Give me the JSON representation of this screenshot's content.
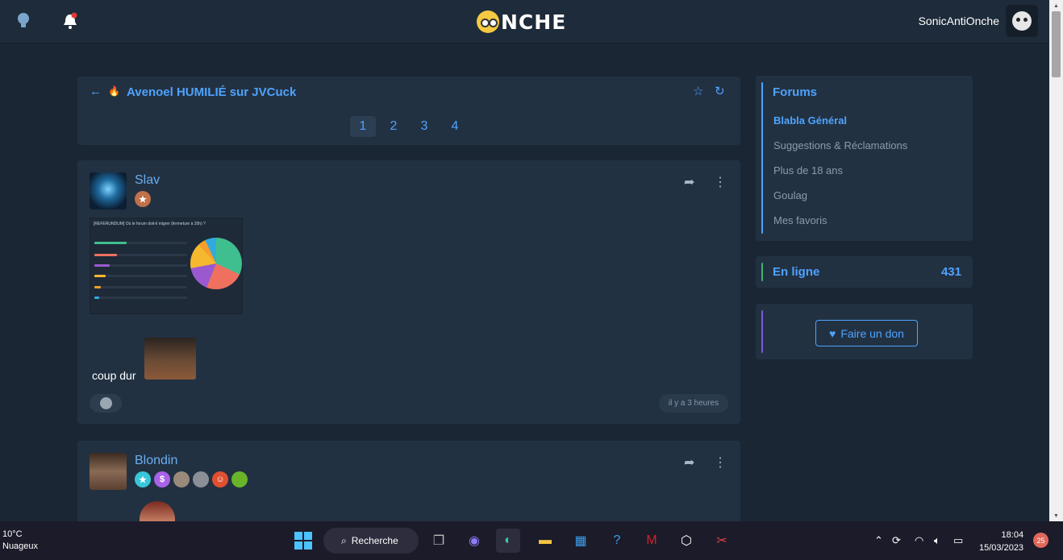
{
  "header": {
    "logo_text": "NCHE",
    "username": "SonicAntiOnche",
    "icons": [
      "lightbulb-icon",
      "bell-icon",
      "onche-face-logo",
      "user-avatar"
    ]
  },
  "topic": {
    "title": "Avenoel HUMILIÉ sur JVCuck",
    "pages": [
      "1",
      "2",
      "3",
      "4"
    ],
    "active_page": "1"
  },
  "posts": [
    {
      "author": "Slav",
      "text": "coup dur",
      "time": "il y a 3 heures",
      "poll_image": {
        "title": "[REFERUNDUM] Où le forum doit-il migrer (fermeture à 20h) ?",
        "slices_percent": [
          32,
          24,
          16,
          16,
          5,
          7
        ],
        "slice_colors": [
          "#3fbf8f",
          "#f07060",
          "#9b59d0",
          "#f5b82e",
          "#f59e2b",
          "#33aadd"
        ]
      }
    },
    {
      "author": "Blondin",
      "badge_colors": [
        "#38c6d9",
        "#a862e8",
        "#9a8a7a",
        "#8a8f96",
        "#e05030",
        "#6ab42a"
      ]
    }
  ],
  "sidebar": {
    "forums_title": "Forums",
    "forums": [
      {
        "label": "Blabla Général",
        "active": true
      },
      {
        "label": "Suggestions & Réclamations",
        "active": false
      },
      {
        "label": "Plus de 18 ans",
        "active": false
      },
      {
        "label": "Goulag",
        "active": false
      },
      {
        "label": "Mes favoris",
        "active": false
      }
    ],
    "online_label": "En ligne",
    "online_count": "431",
    "donate_label": "Faire un don"
  },
  "taskbar": {
    "temperature": "10°C",
    "weather": "Nuageux",
    "search_label": "Recherche",
    "time": "18:04",
    "date": "15/03/2023",
    "notifications": "25"
  },
  "colors": {
    "accent": "#4ea3ff",
    "background": "#1a2634",
    "card": "#223142"
  }
}
